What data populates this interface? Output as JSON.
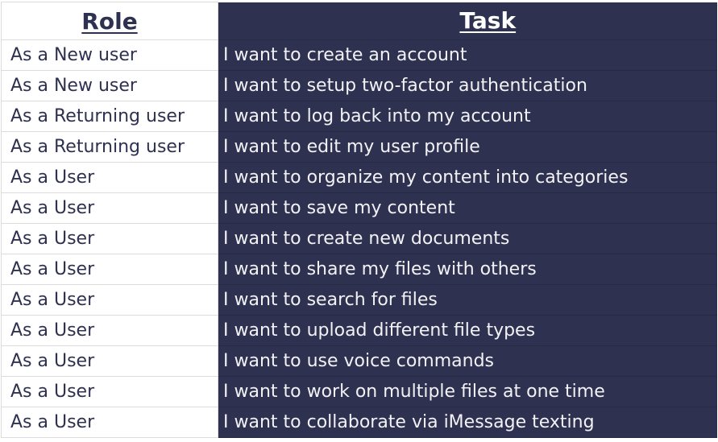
{
  "table": {
    "headers": {
      "role": "Role",
      "task": "Task"
    },
    "colors": {
      "dark_bg": "#2e3150",
      "text_dark": "#2e3150",
      "text_light": "#f2f2f5",
      "light_bg": "#ffffff"
    },
    "rows": [
      {
        "role": "As a New user",
        "task": "I want to create an account"
      },
      {
        "role": "As a New user",
        "task": "I want to setup two-factor authentication"
      },
      {
        "role": "As a Returning user",
        "task": "I want to log back into my account"
      },
      {
        "role": "As a Returning user",
        "task": "I want to edit my user profile"
      },
      {
        "role": "As a User",
        "task": "I want to organize my content into categories"
      },
      {
        "role": "As a User",
        "task": "I want to save my content"
      },
      {
        "role": "As a User",
        "task": "I want to create new documents"
      },
      {
        "role": "As a User",
        "task": "I want to share my files with others"
      },
      {
        "role": "As a User",
        "task": "I want to search for files"
      },
      {
        "role": "As a User",
        "task": "I want to upload different file types"
      },
      {
        "role": "As a User",
        "task": "I want to use voice commands"
      },
      {
        "role": "As a User",
        "task": "I want to work on multiple files at one time"
      },
      {
        "role": "As a User",
        "task": "I want to collaborate via iMessage texting"
      }
    ]
  }
}
